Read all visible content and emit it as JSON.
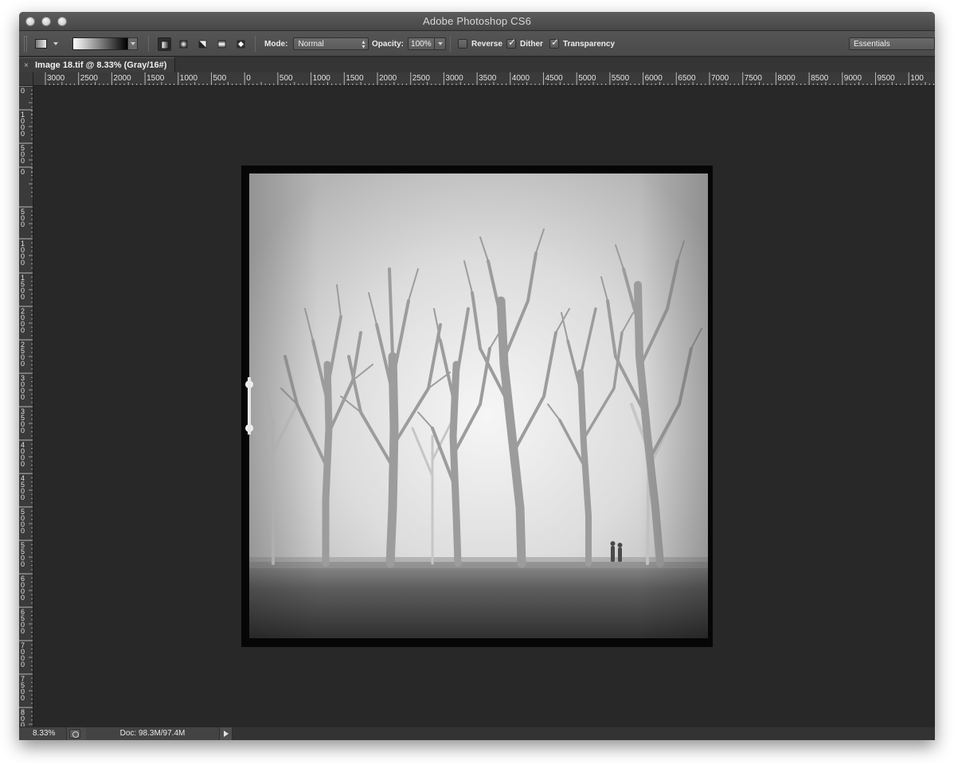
{
  "window": {
    "title": "Adobe Photoshop CS6"
  },
  "options_bar": {
    "mode_label": "Mode:",
    "mode_value": "Normal",
    "opacity_label": "Opacity:",
    "opacity_value": "100%",
    "reverse_label": "Reverse",
    "reverse_checked": false,
    "dither_label": "Dither",
    "dither_checked": true,
    "transparency_label": "Transparency",
    "transparency_checked": true,
    "workspace_value": "Essentials",
    "gradient_types": [
      "linear-gradient-icon",
      "radial-gradient-icon",
      "angle-gradient-icon",
      "reflected-gradient-icon",
      "diamond-gradient-icon"
    ],
    "selected_gradient_type": "linear-gradient-icon"
  },
  "document_tab": {
    "close_glyph": "×",
    "title": "Image 18.tif @ 8.33% (Gray/16#)"
  },
  "rulers": {
    "horizontal_labels": [
      "3000",
      "2500",
      "2000",
      "1500",
      "1000",
      "500",
      "0",
      "500",
      "1000",
      "1500",
      "2000",
      "2500",
      "3000",
      "3500",
      "4000",
      "4500",
      "5000",
      "5500",
      "6000",
      "6500",
      "7000",
      "7500",
      "8000",
      "8500",
      "9000",
      "9500",
      "100"
    ],
    "vertical_labels": [
      "0",
      "1000",
      "500",
      "0",
      "500",
      "1000",
      "1500",
      "2000",
      "2500",
      "3000",
      "3500",
      "4000",
      "4500",
      "5000",
      "5500",
      "6000",
      "6500",
      "7000",
      "7500",
      "8000"
    ]
  },
  "status_bar": {
    "zoom": "8.33%",
    "doc_info": "Doc: 98.3M/97.4M"
  },
  "colors": {
    "window_bg": "#2b2b2b",
    "canvas_bg": "#282828",
    "panel_gray": "#4a4a4a"
  }
}
